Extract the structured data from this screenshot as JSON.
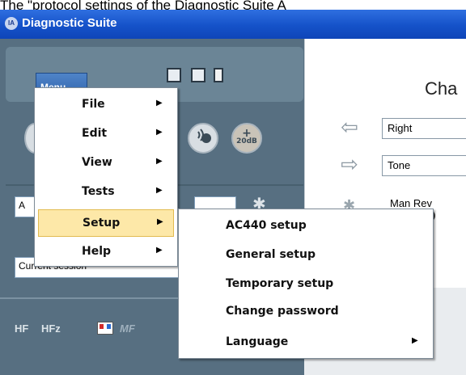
{
  "caption_text": "The \"protocol settings of the Diagnostic Suite A",
  "app": {
    "title": "Diagnostic Suite",
    "logo_text": "IA"
  },
  "toolbar": {
    "menu_label": "Menu",
    "icons": [
      "print-icon",
      "save-icon",
      "exit-door-icon"
    ]
  },
  "round_buttons": [
    "speech-icon",
    "plus-20db-icon"
  ],
  "round_button_label": "20dB",
  "left_fields": {
    "partial_input_text": "A",
    "session_select": "Current session"
  },
  "hf_buttons": [
    "HF",
    "HFz",
    "MF"
  ],
  "right_panel": {
    "title_partial": "Cha",
    "ear_select": "Right",
    "stimulus_select": "Tone",
    "man_rev_label": "Man Rev"
  },
  "main_menu": {
    "items": [
      {
        "label": "File",
        "has_submenu": true
      },
      {
        "label": "Edit",
        "has_submenu": true
      },
      {
        "label": "View",
        "has_submenu": true
      },
      {
        "label": "Tests",
        "has_submenu": true
      },
      {
        "label": "Setup",
        "has_submenu": true,
        "highlighted": true
      },
      {
        "label": "Help",
        "has_submenu": true
      }
    ]
  },
  "setup_submenu": {
    "items": [
      {
        "label": "AC440 setup",
        "has_submenu": false
      },
      {
        "label": "General setup",
        "has_submenu": false
      },
      {
        "label": "Temporary setup",
        "has_submenu": false
      },
      {
        "label": "Change password",
        "has_submenu": false
      },
      {
        "label": "Language",
        "has_submenu": true
      }
    ]
  },
  "colors": {
    "title_bar": "#1552c9",
    "menu_highlight": "#fde8a8",
    "panel_bg": "#576f81"
  }
}
